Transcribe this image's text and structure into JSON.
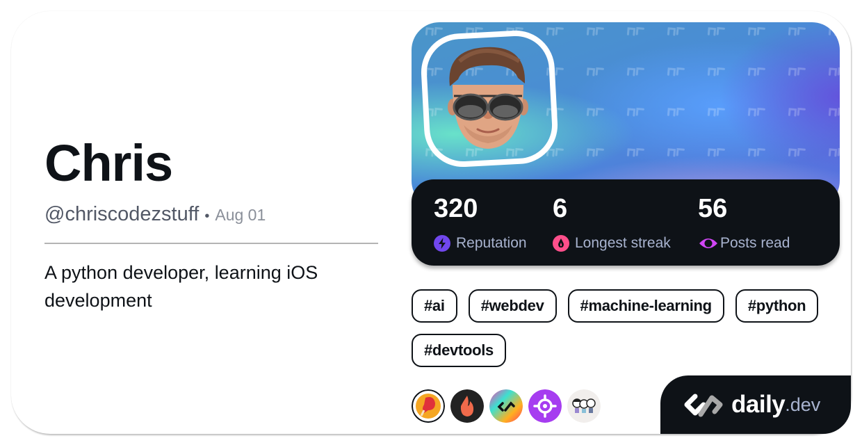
{
  "profile": {
    "name": "Chris",
    "handle": "@chriscodezstuff",
    "separator": "•",
    "joined": "Aug 01",
    "bio": "A python developer, learning iOS development"
  },
  "stats": [
    {
      "value": "320",
      "label": "Reputation",
      "icon": "lightning-icon",
      "color": "#7147ed"
    },
    {
      "value": "6",
      "label": "Longest streak",
      "icon": "flame-icon",
      "color": "#ff4f8b"
    },
    {
      "value": "56",
      "label": "Posts read",
      "icon": "eye-icon",
      "color": "#d146f5"
    }
  ],
  "tags": [
    "#ai",
    "#webdev",
    "#machine-learning",
    "#python",
    "#devtools"
  ],
  "badges": [
    {
      "name": "boxing-glove-badge"
    },
    {
      "name": "fire-badge"
    },
    {
      "name": "rainbow-daily-badge"
    },
    {
      "name": "target-badge"
    },
    {
      "name": "characters-badge"
    }
  ],
  "brand": {
    "logo_text": "daily",
    "logo_tld": ".dev",
    "dark": "#0e1217",
    "text_secondary": "#a8b3cf"
  }
}
